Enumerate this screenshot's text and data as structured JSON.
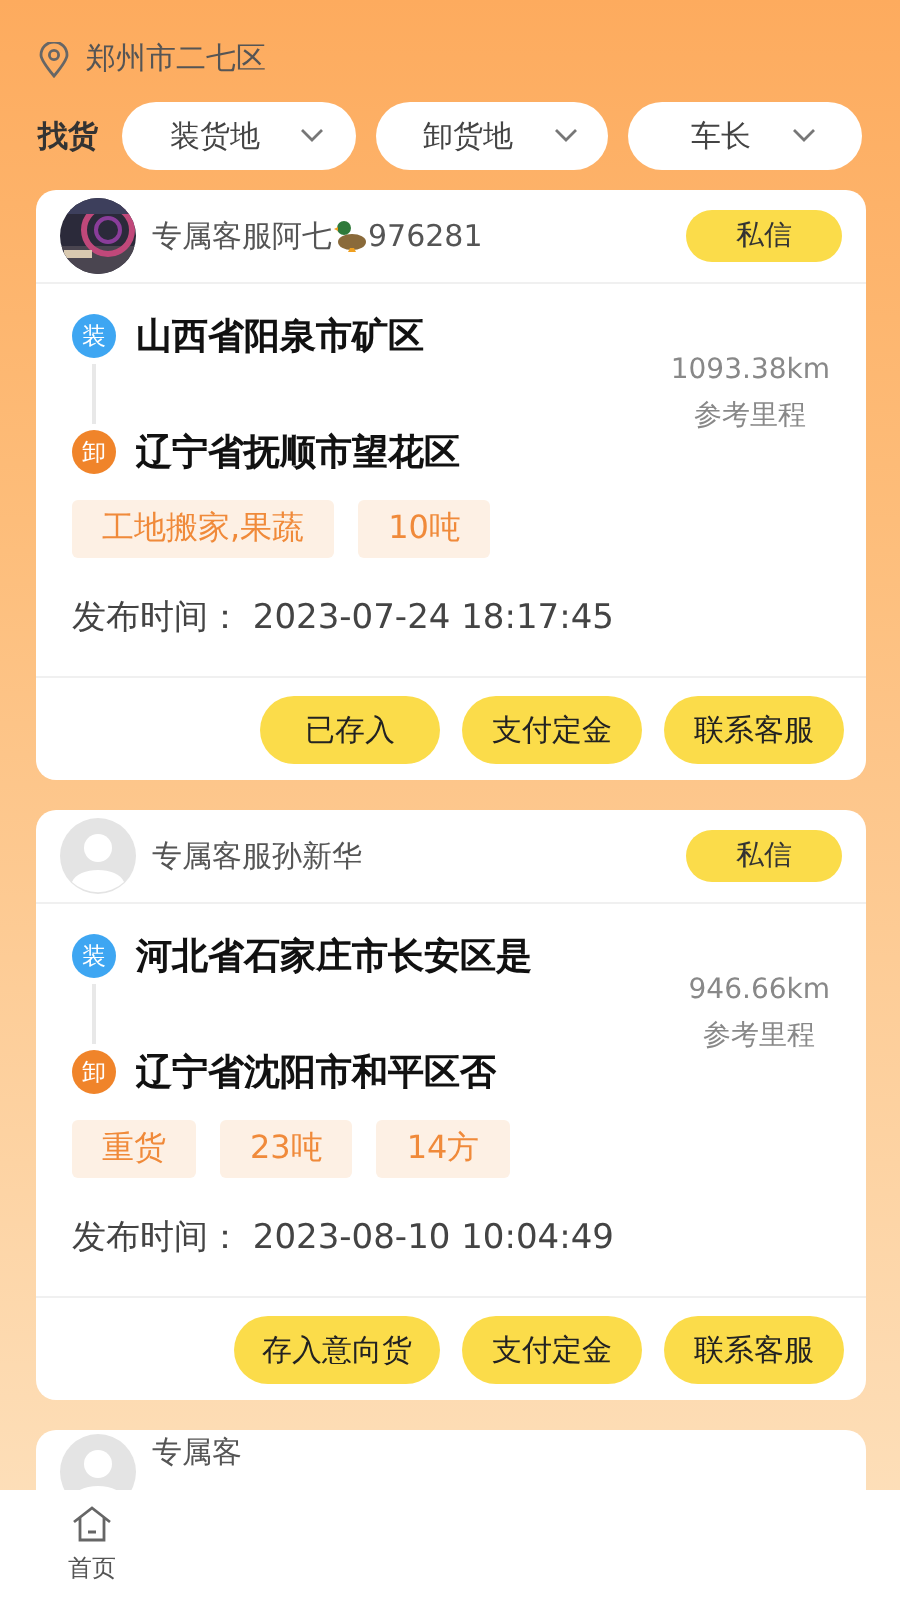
{
  "location": "郑州市二七区",
  "filter_label": "找货",
  "filters": [
    {
      "label": "装货地"
    },
    {
      "label": "卸货地"
    },
    {
      "label": "车长"
    }
  ],
  "orders": [
    {
      "agent": "专属客服阿七",
      "agent_suffix": "976281",
      "avatar": {
        "kind": "picture"
      },
      "message_button": "私信",
      "load_tag": "装",
      "load": "山西省阳泉市矿区",
      "unload_tag": "卸",
      "unload": "辽宁省抚顺市望花区",
      "distance": "1093.38km",
      "distance_label": "参考里程",
      "tags": [
        "工地搬家,果蔬",
        "10吨"
      ],
      "time_label": "发布时间：",
      "time": "2023-07-24 18:17:45",
      "actions": [
        "已存入",
        "支付定金",
        "联系客服"
      ]
    },
    {
      "agent": "专属客服孙新华",
      "avatar": {
        "kind": "silhouette"
      },
      "message_button": "私信",
      "load_tag": "装",
      "load": "河北省石家庄市长安区是",
      "unload_tag": "卸",
      "unload": "辽宁省沈阳市和平区否",
      "distance": "946.66km",
      "distance_label": "参考里程",
      "tags": [
        "重货",
        "23吨",
        "14方"
      ],
      "time_label": "发布时间：",
      "time": "2023-08-10 10:04:49",
      "actions": [
        "存入意向货",
        "支付定金",
        "联系客服"
      ]
    },
    {
      "agent": "专属客",
      "avatar": {
        "kind": "silhouette"
      }
    }
  ],
  "nav": [
    {
      "label": "首页",
      "selected": false
    }
  ]
}
